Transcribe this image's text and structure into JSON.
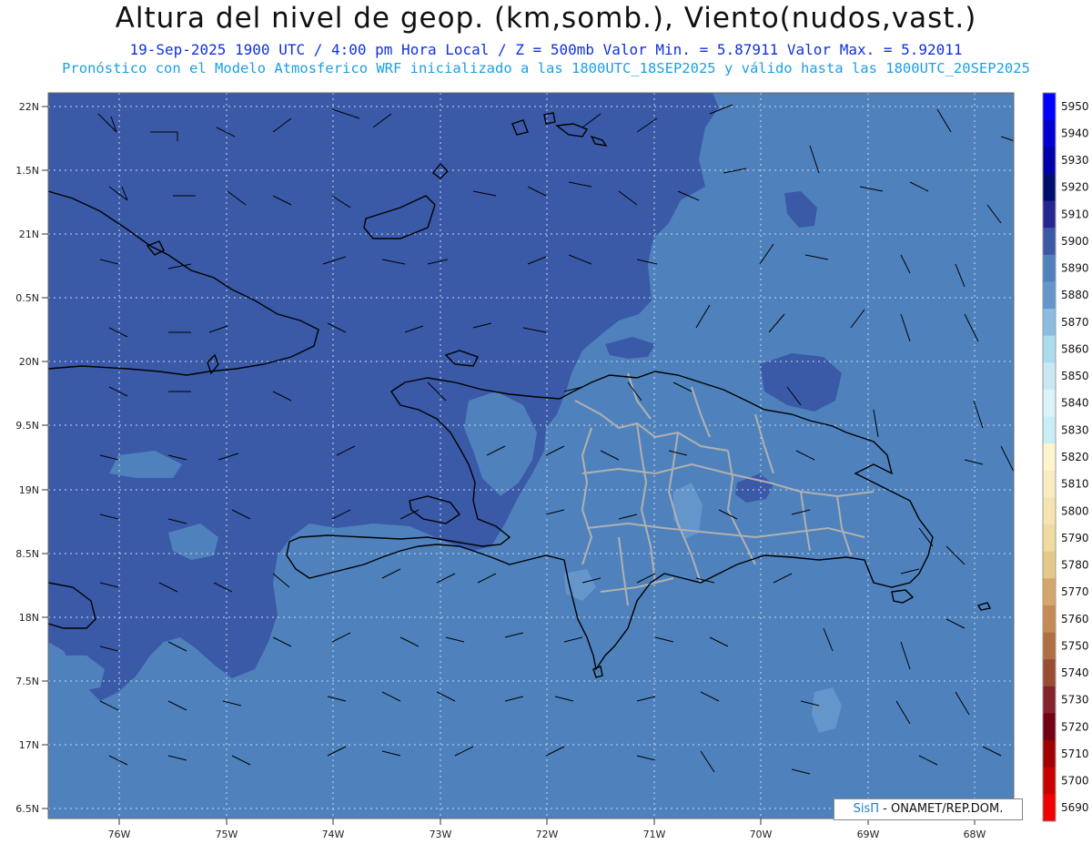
{
  "header": {
    "title": "Altura del nivel de geop. (km,somb.), Viento(nudos,vast.)",
    "line2": "19-Sep-2025  1900 UTC / 4:00 pm Hora Local / Z = 500mb     Valor Min. = 5.87911  Valor Max. = 5.92011",
    "line3": "Pronóstico con el Modelo Atmosferico WRF inicializado a las 1800UTC_18SEP2025 y válido hasta las  1800UTC_20SEP2025"
  },
  "map": {
    "lat_labels": [
      "22N",
      "1.5N",
      "21N",
      "0.5N",
      "20N",
      "9.5N",
      "19N",
      "8.5N",
      "18N",
      "7.5N",
      "17N",
      "6.5N"
    ],
    "lon_labels": [
      "76W",
      "75W",
      "74W",
      "73W",
      "72W",
      "71W",
      "70W",
      "69W",
      "68W"
    ],
    "fill_colors": {
      "z5900": "#3a5aa8",
      "z5890": "#4f82bd",
      "z5880": "#6496cc",
      "coast": "#000000",
      "provinces": "#b0b0b0"
    }
  },
  "colorbar": {
    "levels": [
      "5950",
      "5940",
      "5930",
      "5920",
      "5910",
      "5900",
      "5890",
      "5880",
      "5870",
      "5860",
      "5850",
      "5840",
      "5830",
      "5820",
      "5810",
      "5800",
      "5790",
      "5780",
      "5770",
      "5760",
      "5750",
      "5740",
      "5730",
      "5720",
      "5710",
      "5700",
      "5690"
    ],
    "colors": [
      "#0000ff",
      "#0000d2",
      "#0000aa",
      "#000e6e",
      "#262690",
      "#3a5aa8",
      "#4f82bd",
      "#6496cc",
      "#8cbde0",
      "#aadcee",
      "#c8e9f3",
      "#dcf3fa",
      "#c8eff6",
      "#fff5cc",
      "#f8ecc0",
      "#f5e4b0",
      "#efdaa0",
      "#e6c78a",
      "#d4a66a",
      "#c48c54",
      "#b06f42",
      "#9a4d32",
      "#86232a",
      "#740014",
      "#a00000",
      "#c80000",
      "#f00000"
    ]
  },
  "credit": {
    "brand": "SisΠ",
    "text": " - ONAMET/REP.DOM."
  }
}
